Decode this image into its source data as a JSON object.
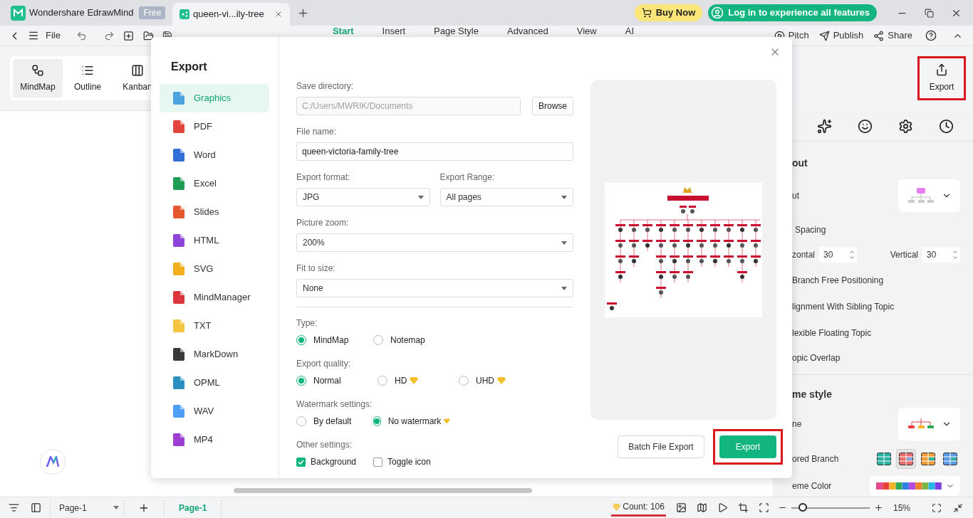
{
  "app": {
    "title": "Wondershare EdrawMind",
    "plan_badge": "Free"
  },
  "document_tab": {
    "title": "queen-vi...ily-tree"
  },
  "header_buttons": {
    "buy": "Buy Now",
    "login": "Log in to experience all features"
  },
  "menu": {
    "file": "File",
    "tabs": [
      {
        "label": "Start",
        "selected": true
      },
      {
        "label": "Insert",
        "selected": false
      },
      {
        "label": "Page Style",
        "selected": false
      },
      {
        "label": "Advanced",
        "selected": false
      },
      {
        "label": "View",
        "selected": false
      },
      {
        "label": "AI",
        "selected": false
      }
    ],
    "actions": [
      {
        "label": "Pitch",
        "kind": "pitch"
      },
      {
        "label": "Publish",
        "kind": "publish"
      },
      {
        "label": "Share",
        "kind": "share"
      }
    ]
  },
  "views": [
    {
      "label": "MindMap",
      "kind": "mindmap",
      "selected": true
    },
    {
      "label": "Outline",
      "kind": "outline",
      "selected": false
    },
    {
      "label": "Kanban",
      "kind": "kanban",
      "selected": false
    }
  ],
  "export_button": {
    "label": "Export",
    "highlighted": true
  },
  "dialog": {
    "title": "Export",
    "formats": [
      {
        "label": "Graphics",
        "color": "#4aa3df",
        "selected": true
      },
      {
        "label": "PDF",
        "color": "#e0443a",
        "selected": false
      },
      {
        "label": "Word",
        "color": "#2f6fd6",
        "selected": false
      },
      {
        "label": "Excel",
        "color": "#1f9d55",
        "selected": false
      },
      {
        "label": "Slides",
        "color": "#e4572e",
        "selected": false
      },
      {
        "label": "HTML",
        "color": "#8e44d9",
        "selected": false
      },
      {
        "label": "SVG",
        "color": "#f2b01e",
        "selected": false
      },
      {
        "label": "MindManager",
        "color": "#d9363e",
        "selected": false
      },
      {
        "label": "TXT",
        "color": "#f5c542",
        "selected": false
      },
      {
        "label": "MarkDown",
        "color": "#3a3a3a",
        "selected": false
      },
      {
        "label": "OPML",
        "color": "#2b8fbf",
        "selected": false
      },
      {
        "label": "WAV",
        "color": "#4e9ef5",
        "selected": false
      },
      {
        "label": "MP4",
        "color": "#9b3fd1",
        "selected": false
      }
    ],
    "save_directory": {
      "label": "Save directory:",
      "value": "C:/Users/MWRIK/Documents",
      "disabled": true,
      "button": "Browse"
    },
    "file_name": {
      "label": "File name:",
      "value": "queen-victoria-family-tree"
    },
    "export_format": {
      "label": "Export format:",
      "value": "JPG"
    },
    "export_range": {
      "label": "Export Range:",
      "value": "All pages"
    },
    "picture_zoom": {
      "label": "Picture zoom:",
      "value": "200%"
    },
    "fit_to_size": {
      "label": "Fit to size:",
      "value": "None"
    },
    "radio_groups": [
      {
        "label": "Type:",
        "options": [
          {
            "label": "MindMap",
            "selected": true,
            "premium": false
          },
          {
            "label": "Notemap",
            "selected": false,
            "premium": false
          }
        ]
      },
      {
        "label": "Export quality:",
        "options": [
          {
            "label": "Normal",
            "selected": true,
            "premium": false
          },
          {
            "label": "HD",
            "selected": false,
            "premium": true
          },
          {
            "label": "UHD",
            "selected": false,
            "premium": true
          }
        ]
      },
      {
        "label": "Watermark settings:",
        "options": [
          {
            "label": "By default",
            "selected": false,
            "premium": false
          },
          {
            "label": "No watermark",
            "selected": true,
            "premium": true
          }
        ]
      }
    ],
    "other_settings": {
      "label": "Other settings:",
      "options": [
        {
          "label": "Background",
          "checked": true
        },
        {
          "label": "Toggle icon",
          "checked": false
        }
      ]
    },
    "buttons": [
      {
        "label": "Batch File Export",
        "kind": "secondary",
        "highlighted": false
      },
      {
        "label": "Export",
        "kind": "primary",
        "highlighted": true
      }
    ]
  },
  "right_panel": {
    "layout_heading": "out",
    "layout_label": "ut",
    "spacing_label": "Spacing",
    "horizontal_label": "zontal",
    "horizontal_value": "30",
    "vertical_label": "Vertical",
    "vertical_value": "30",
    "options": [
      "Branch Free Positioning",
      "lignment With Sibling Topic",
      "lexible Floating Topic",
      "opic Overlap"
    ],
    "theme_heading": "me style",
    "theme_label": "ne",
    "colored_branch_label": "ored Branch",
    "branch_styles": [
      {
        "selected": false
      },
      {
        "selected": true
      },
      {
        "selected": false
      },
      {
        "selected": false
      }
    ],
    "theme_color_label": "eme Color"
  },
  "status_bar": {
    "page_select": "Page-1",
    "page_tab": {
      "label": "Page-1",
      "selected": true
    },
    "count": "Count: 106",
    "zoom": {
      "level": 0.15,
      "reading": "15%"
    }
  }
}
